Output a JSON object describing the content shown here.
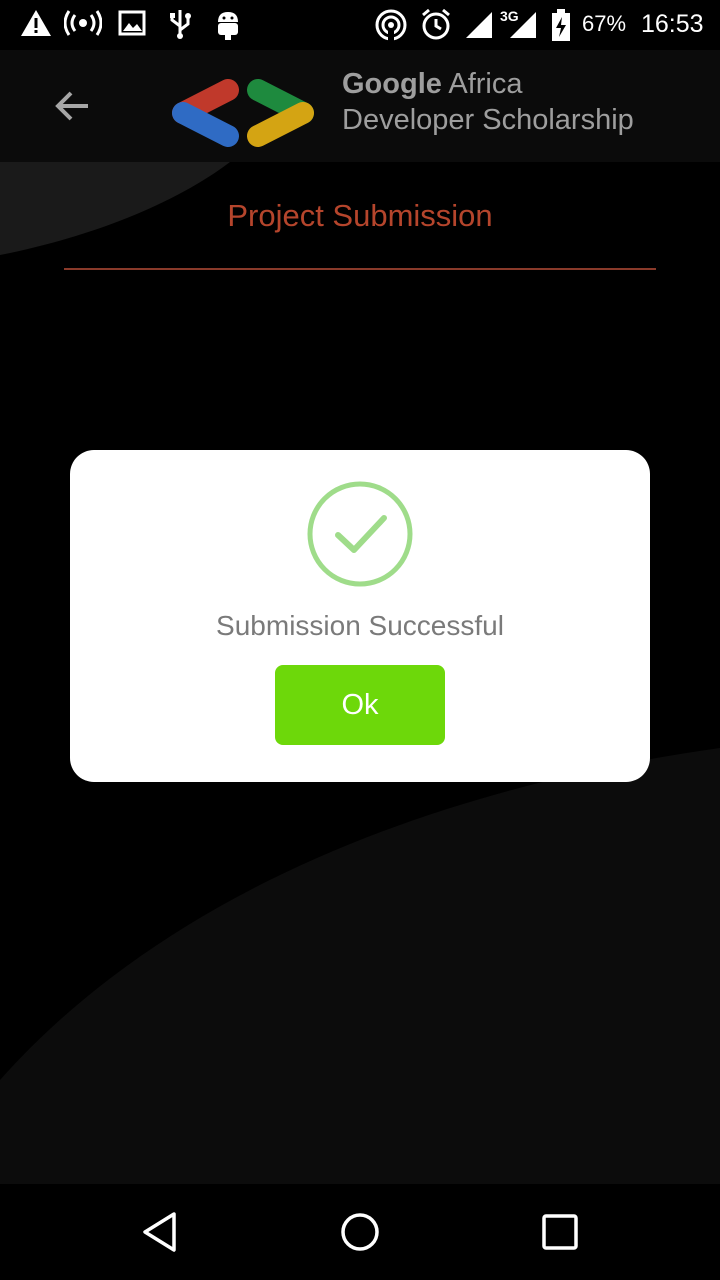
{
  "status_bar": {
    "battery": "67%",
    "time": "16:53",
    "network": "3G",
    "icons": [
      "warning-icon",
      "hotspot-icon",
      "image-icon",
      "usb-icon",
      "android-icon",
      "cast-icon",
      "alarm-icon",
      "signal-icon",
      "battery-charging-icon"
    ]
  },
  "header": {
    "back_icon": "arrow-back-icon",
    "brand_bold": "Google",
    "brand_rest": " Africa",
    "brand_line2": "Developer Scholarship",
    "logo_colors": {
      "red": "#c0392b",
      "blue": "#2f6bc4",
      "green": "#1e8a3e",
      "yellow": "#d4a413"
    }
  },
  "page": {
    "title": "Project Submission",
    "accent": "#b5452c"
  },
  "dialog": {
    "message": "Submission Successful",
    "ok_label": "Ok",
    "check_color": "#9fdc8a",
    "button_color": "#6dd80a"
  },
  "nav": {
    "icons": [
      "back-triangle-icon",
      "home-circle-icon",
      "recents-square-icon"
    ]
  }
}
